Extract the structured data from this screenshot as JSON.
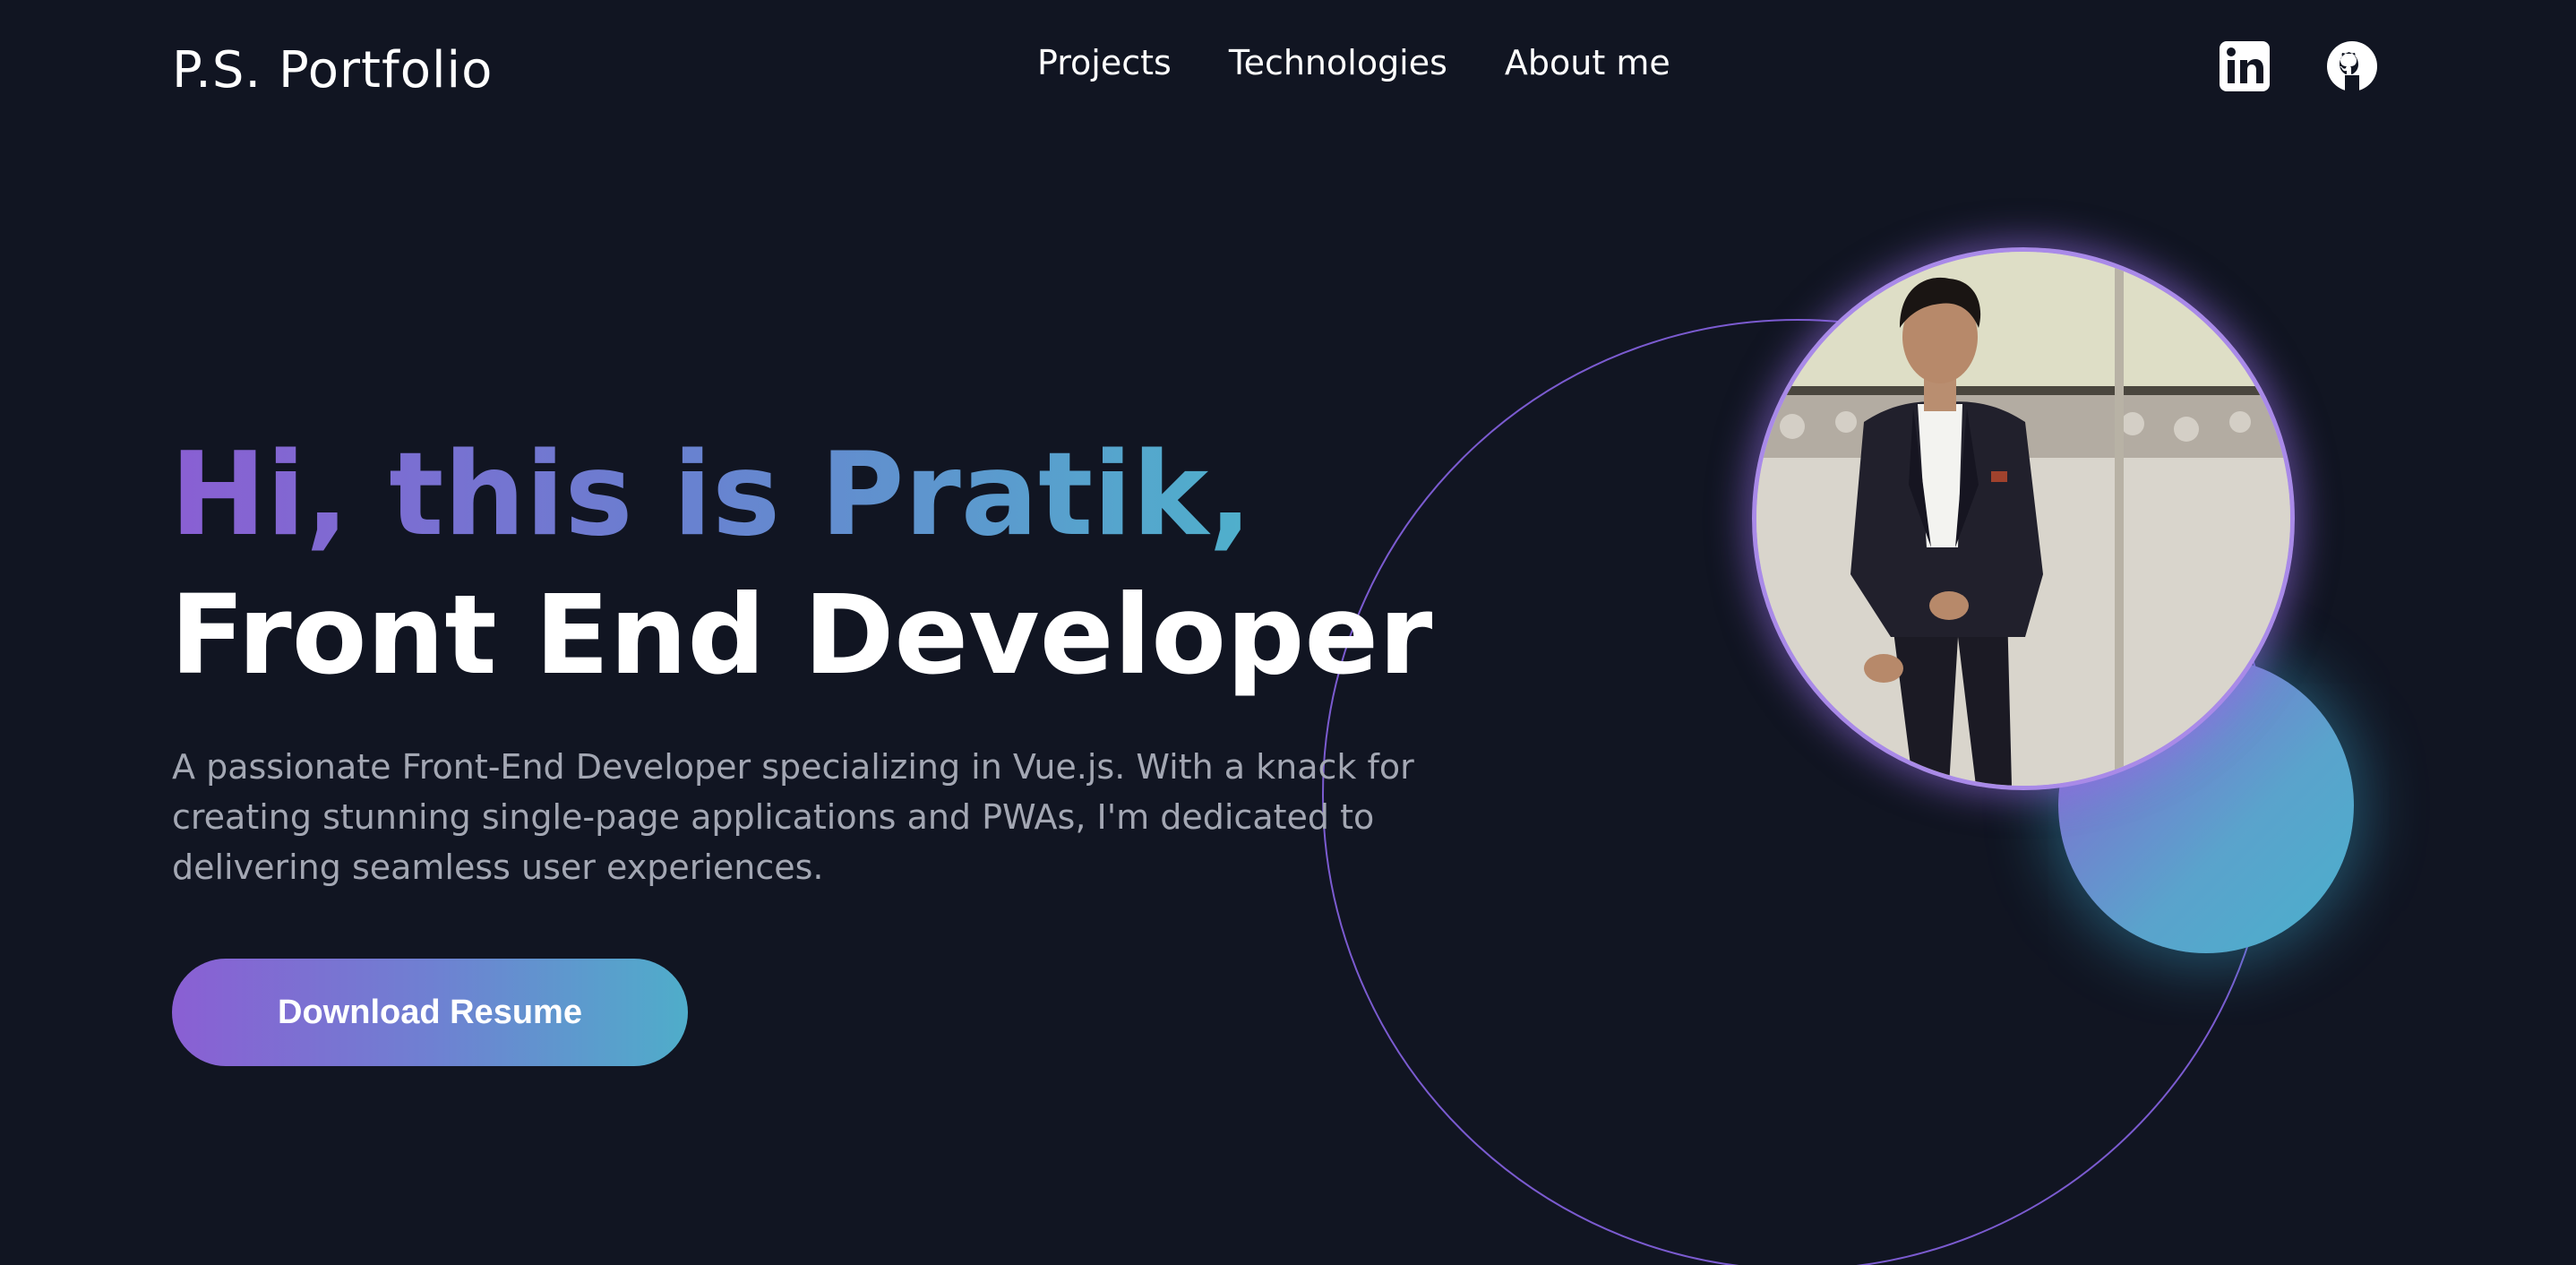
{
  "header": {
    "logo": "P.S. Portfolio",
    "nav": [
      "Projects",
      "Technologies",
      "About me"
    ],
    "social": [
      "linkedin-icon",
      "github-icon"
    ]
  },
  "hero": {
    "greeting": "Hi, this is Pratik,",
    "role": "Front End Developer",
    "description": "A passionate Front-End Developer specializing in Vue.js. With a knack for creating stunning single-page applications and PWAs, I'm dedicated to delivering seamless user experiences.",
    "cta_label": "Download Resume"
  },
  "colors": {
    "background": "#111522",
    "accent_purple": "#8a5fd3",
    "accent_blue": "#4fb0cc",
    "muted_text": "#a3a7b3"
  }
}
